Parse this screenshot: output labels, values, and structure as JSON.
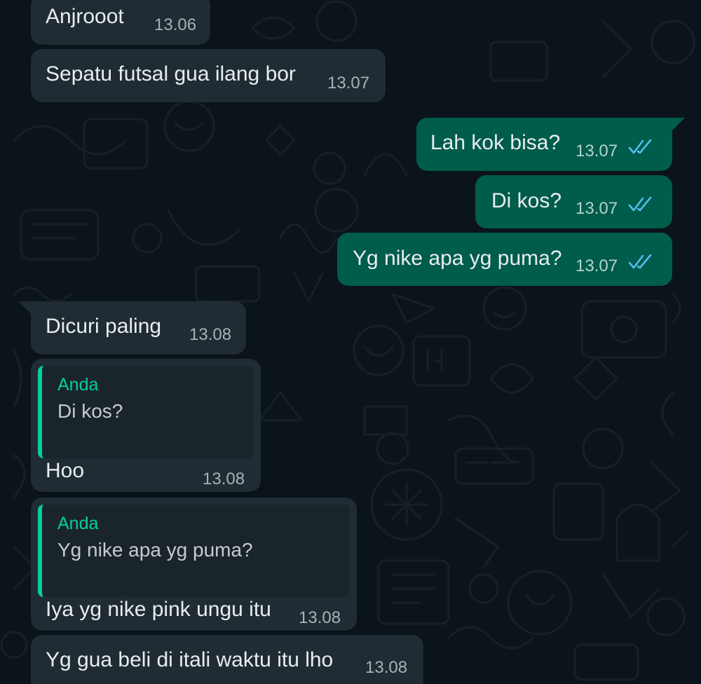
{
  "colors": {
    "background": "#0b141a",
    "incoming_bubble": "#202c33",
    "outgoing_bubble": "#005c4b",
    "quote_accent": "#06cf9c",
    "read_ticks": "#53bdeb"
  },
  "messages": [
    {
      "direction": "incoming",
      "text": "Anjrooot",
      "time": "13.06"
    },
    {
      "direction": "incoming",
      "text": "Sepatu futsal gua ilang bor",
      "time": "13.07"
    },
    {
      "direction": "outgoing",
      "text": "Lah kok bisa?",
      "time": "13.07",
      "status_icon": "double-check-read-icon"
    },
    {
      "direction": "outgoing",
      "text": "Di kos?",
      "time": "13.07",
      "status_icon": "double-check-read-icon"
    },
    {
      "direction": "outgoing",
      "text": "Yg nike apa yg puma?",
      "time": "13.07",
      "status_icon": "double-check-read-icon"
    },
    {
      "direction": "incoming",
      "text": "Dicuri paling",
      "time": "13.08"
    },
    {
      "direction": "incoming",
      "text": "Hoo",
      "time": "13.08",
      "reply_to": {
        "author": "Anda",
        "text": "Di kos?"
      }
    },
    {
      "direction": "incoming",
      "text": "Iya yg nike pink ungu itu",
      "time": "13.08",
      "reply_to": {
        "author": "Anda",
        "text": "Yg nike apa yg puma?"
      }
    },
    {
      "direction": "incoming",
      "text": "Yg gua beli di itali waktu itu lho",
      "time": "13.08"
    }
  ]
}
